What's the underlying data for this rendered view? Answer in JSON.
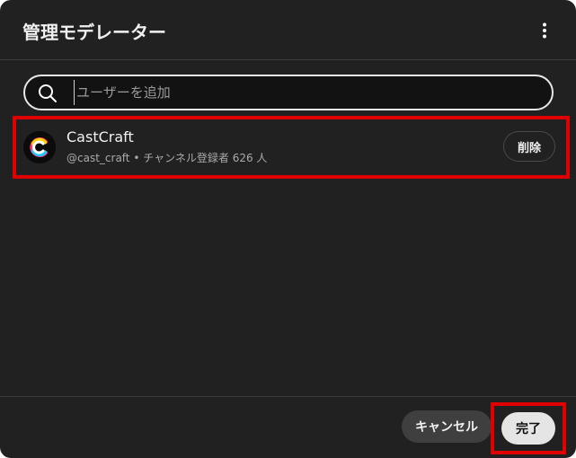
{
  "dialog": {
    "title": "管理モデレーター",
    "more_icon": "vertical-dots-icon"
  },
  "search": {
    "placeholder": "ユーザーを追加",
    "value": "",
    "icon": "search-icon"
  },
  "moderators": [
    {
      "name": "CastCraft",
      "handle": "@cast_craft",
      "separator": "•",
      "subscribers": "チャンネル登録者 626 人",
      "remove_label": "削除",
      "avatar_icon": "castcraft-logo-icon"
    }
  ],
  "footer": {
    "cancel_label": "キャンセル",
    "done_label": "完了"
  },
  "colors": {
    "dialog_bg": "#212121",
    "highlight": "#e00000",
    "done_bg": "#e5e5e5"
  }
}
